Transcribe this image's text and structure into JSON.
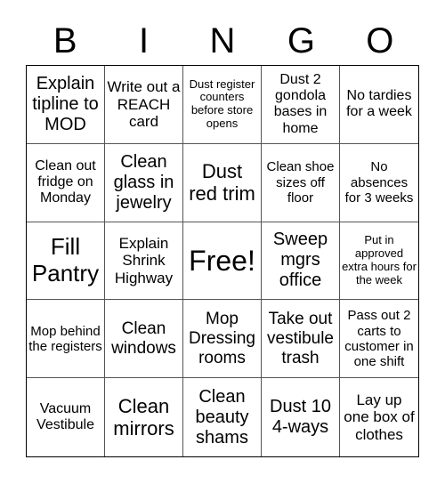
{
  "title_letters": [
    "B",
    "I",
    "N",
    "G",
    "O"
  ],
  "cells": [
    "Explain tipline to MOD",
    "Write out a REACH card",
    "Dust register counters before store opens",
    "Dust 2 gondola bases in home",
    "No tardies for a week",
    "Clean out fridge on Monday",
    "Clean glass in jewelry",
    "Dust red trim",
    "Clean shoe sizes off floor",
    "No absences for 3 weeks",
    "Fill Pantry",
    "Explain Shrink Highway",
    "Free!",
    "Sweep mgrs office",
    "Put in approved extra hours for the week",
    "Mop behind the registers",
    "Clean windows",
    "Mop Dressing rooms",
    "Take out vestibule trash",
    "Pass out 2 carts to customer in one shift",
    "Vacuum Vestibule",
    "Clean mirrors",
    "Clean beauty shams",
    "Dust 10 4-ways",
    "Lay up one box of clothes"
  ]
}
